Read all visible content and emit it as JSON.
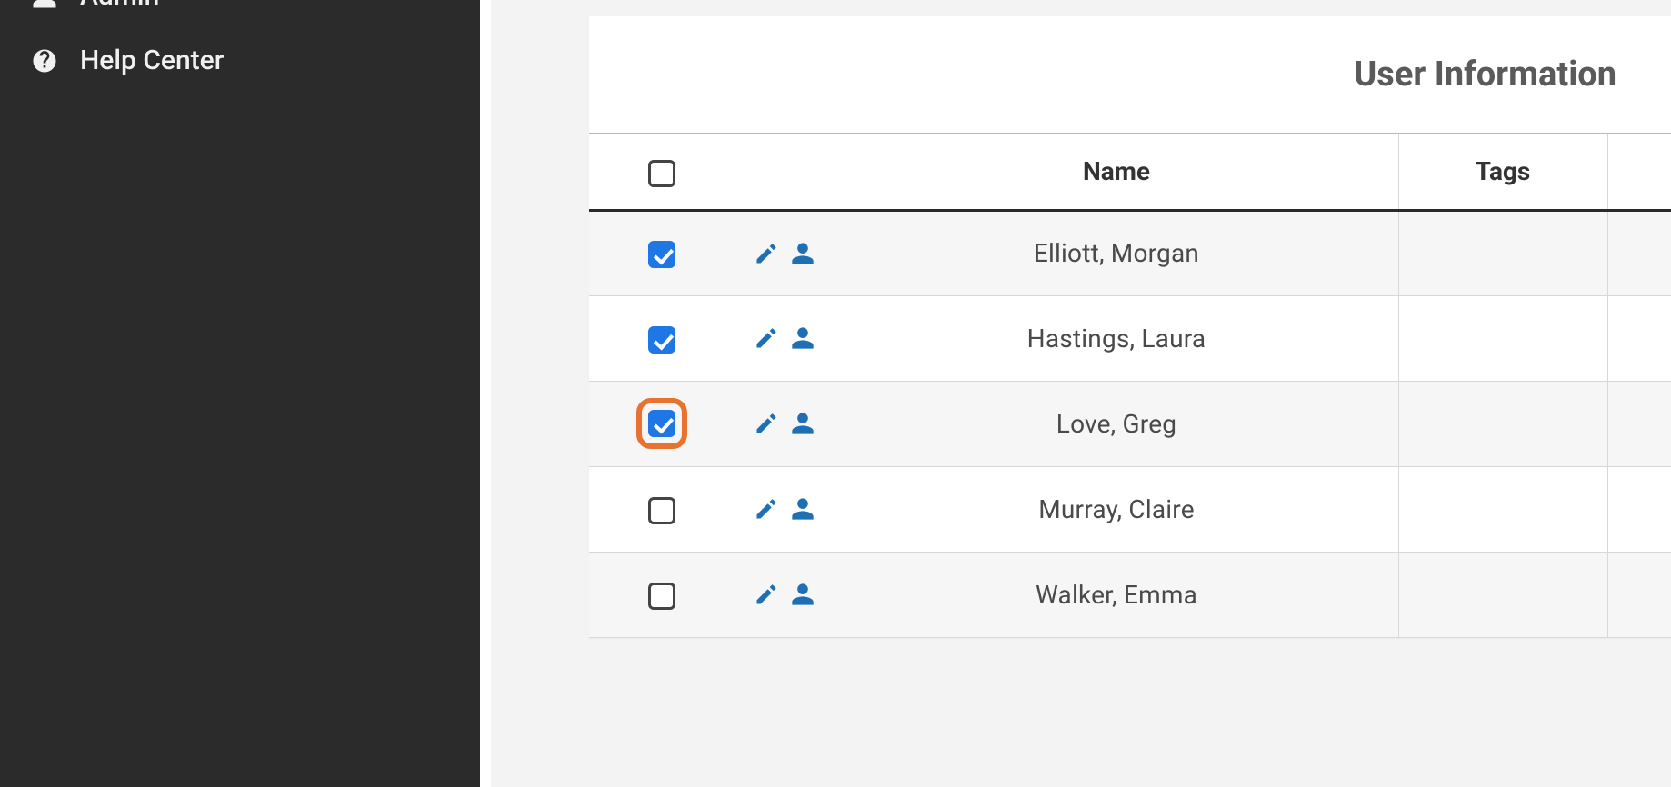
{
  "sidebar": {
    "items": [
      {
        "label": "Admin",
        "icon": "user-icon"
      },
      {
        "label": "Help Center",
        "icon": "help-icon"
      }
    ]
  },
  "panel": {
    "title": "User Information"
  },
  "table": {
    "columns": {
      "name": "Name",
      "tags": "Tags"
    },
    "select_all_checked": false,
    "rows": [
      {
        "name": "Elliott, Morgan",
        "checked": true,
        "highlighted": false,
        "tags": ""
      },
      {
        "name": "Hastings, Laura",
        "checked": true,
        "highlighted": false,
        "tags": ""
      },
      {
        "name": "Love, Greg",
        "checked": true,
        "highlighted": true,
        "tags": ""
      },
      {
        "name": "Murray, Claire",
        "checked": false,
        "highlighted": false,
        "tags": ""
      },
      {
        "name": "Walker, Emma",
        "checked": false,
        "highlighted": false,
        "tags": ""
      }
    ]
  },
  "icons": {
    "edit": "edit-icon",
    "user": "user-icon"
  },
  "colors": {
    "accent_blue": "#1f77e6",
    "link_blue": "#1a6fb5",
    "highlight_orange": "#e87330",
    "sidebar_bg": "#2b2b2b"
  }
}
